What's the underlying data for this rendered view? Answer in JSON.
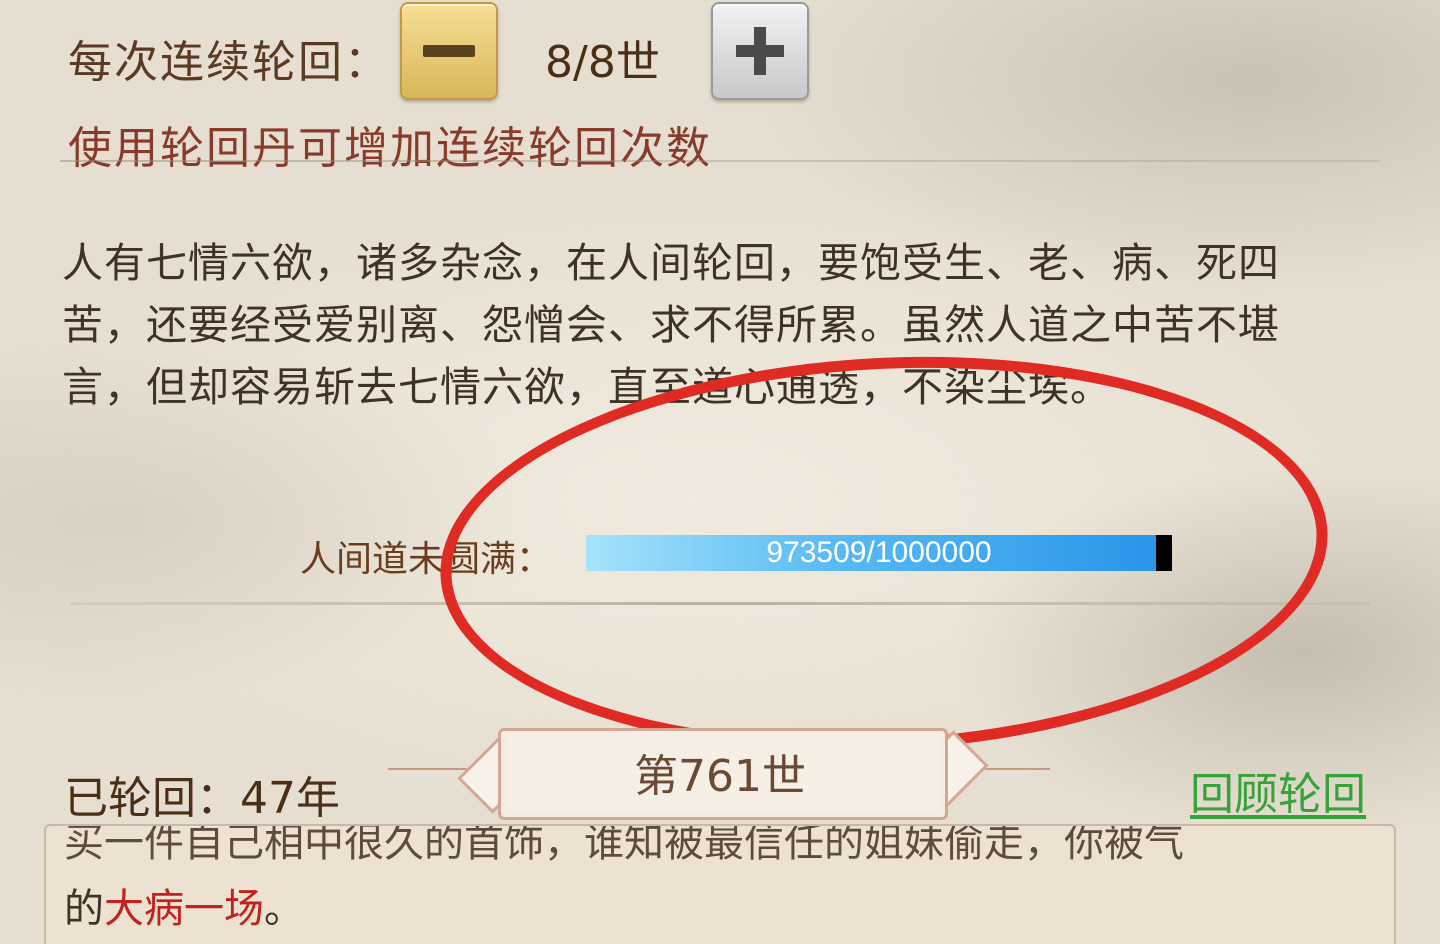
{
  "header": {
    "continuous_label": "每次连续轮回：",
    "count_value": "8/8世",
    "minus_icon": "minus-icon",
    "plus_icon": "plus-icon",
    "hint": "使用轮回丹可增加连续轮回次数"
  },
  "description": {
    "line1": "人有七情六欲，诸多杂念，在人间轮回，要饱受生、老、病、死四",
    "line2": "苦，还要经受爱别离、怨憎会、求不得所累。虽然人道之中苦不堪",
    "line3": "言，但却容易斩去七情六欲，直至道心通透，不染尘埃。"
  },
  "progress": {
    "label": "人间道未圆满：",
    "text": "973509/1000000",
    "current": 973509,
    "max": 1000000
  },
  "status": {
    "reincarnated_label": "已轮回：47年",
    "life_banner": "第761世",
    "review_link": "回顾轮回"
  },
  "log": {
    "previous_partial": "买一件自己相中很久的首饰，谁知被最信任的姐妹偷走，你被气",
    "prefix": "的",
    "highlight": "大病一场",
    "suffix": "。"
  },
  "colors": {
    "annotation_ring": "#e02a24",
    "review_link": "#36a33a",
    "highlight": "#c1221b",
    "progress_fill": "#2a95ea"
  }
}
